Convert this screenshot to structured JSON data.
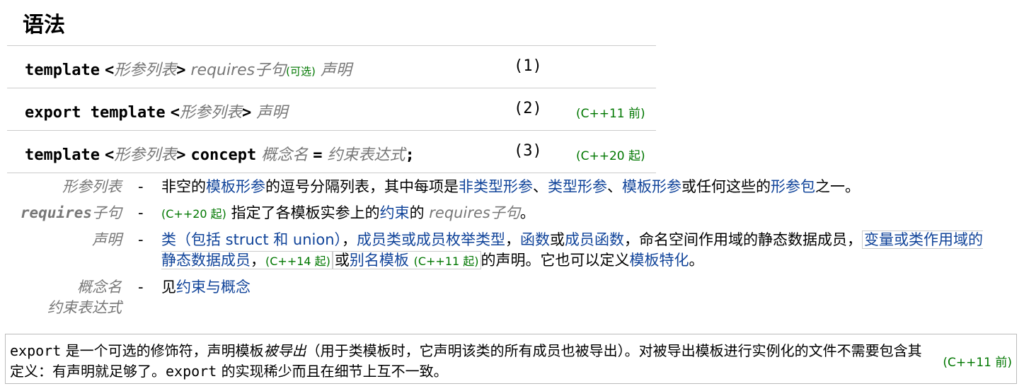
{
  "heading": "语法",
  "syntax": [
    {
      "kw1": "template",
      "lt": "<",
      "param": "形参列表",
      "gt": ">",
      "req_kw": "requires子句",
      "opt": "(可选)",
      "decl": "声明",
      "num": "(1)",
      "ver": ""
    },
    {
      "kw1": "export template",
      "lt": "<",
      "param": "形参列表",
      "gt": ">",
      "decl": "声明",
      "num": "(2)",
      "ver": "(C++11 前)"
    },
    {
      "kw1": "template",
      "lt": "<",
      "param": "形参列表",
      "gt": ">",
      "kw2": "concept",
      "cname": "概念名",
      "eq": "=",
      "cexpr": "约束表达式",
      "semi": ";",
      "num": "(3)",
      "ver": "(C++20 起)"
    }
  ],
  "params": {
    "p1": {
      "name": "形参列表",
      "dash": "-",
      "t1": "非空的",
      "l1": "模板形参",
      "t2": "的逗号分隔列表，其中每项是",
      "l2": "非类型形参",
      "t3": "、",
      "l3": "类型形参",
      "t4": "、",
      "l4": "模板形参",
      "t5": "或任何这些的",
      "l5": "形参包",
      "t6": "之一。"
    },
    "p2": {
      "name_mono": "requires",
      "name_rest": "子句",
      "dash": "-",
      "ver": "(C++20 起)",
      "t1": " 指定了各模板实参上的",
      "l1": "约束",
      "t2": "的 ",
      "ital": "requires子句",
      "t3": "。"
    },
    "p3": {
      "name": "声明",
      "dash": "-",
      "l1": "类（包括 struct 和 union）",
      "t1": "，",
      "l2": "成员类或成员枚举类型",
      "t2": "，",
      "l3": "函数",
      "t3": "或",
      "l4": "成员函数",
      "t4": "，命名空间作用域的静态数据成员，",
      "l5": "变量或类作用域的静态数据成员",
      "t5": "，",
      "ver1": "(C++14 起)",
      "t6": "或",
      "l6": "别名模板",
      "ver2": "(C++11 起)",
      "t7": "的声明。它也可以定义",
      "l7": "模板特化",
      "t8": "。"
    },
    "p4": {
      "name1": "概念名",
      "name2": "约束表达式",
      "dash": "-",
      "t1": "见",
      "l1": "约束与概念"
    }
  },
  "note": {
    "code1": "export",
    "t1": " 是一个可选的修饰符，声明模板",
    "ital": "被导出",
    "t2": "（用于类模板时，它声明该类的所有成员也被导出）。对被导出模板进行实例化的文件不需要包含其定义：有声明就足够了。",
    "code2": "export",
    "t3": " 的实现稀少而且在细节上互不一致。",
    "ver": "(C++11 前)"
  }
}
